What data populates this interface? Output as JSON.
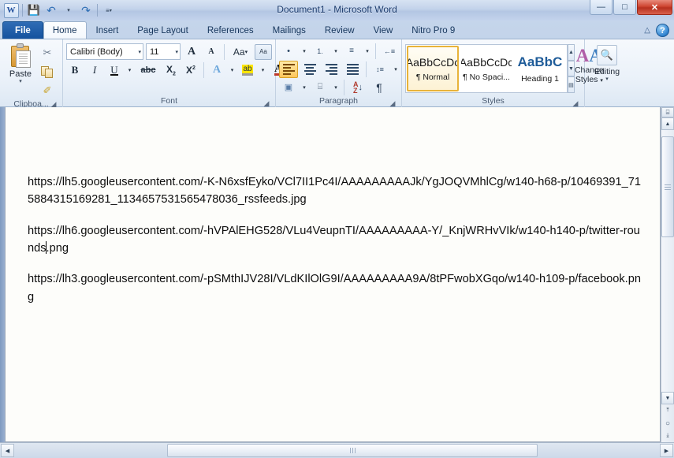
{
  "window": {
    "title": "Document1 - Microsoft Word",
    "quick_access": [
      {
        "name": "word-logo",
        "glyph": "W"
      },
      {
        "name": "save",
        "glyph": "💾"
      },
      {
        "name": "undo",
        "glyph": "↶"
      },
      {
        "name": "undo-dropdown",
        "glyph": "▾"
      },
      {
        "name": "redo",
        "glyph": "↷"
      },
      {
        "name": "customize-qat",
        "glyph": "▾"
      }
    ],
    "controls": {
      "minimize": "—",
      "maximize": "□",
      "close": "✕"
    }
  },
  "tabs": [
    {
      "label": "File",
      "active": false,
      "file": true
    },
    {
      "label": "Home",
      "active": true
    },
    {
      "label": "Insert",
      "active": false
    },
    {
      "label": "Page Layout",
      "active": false
    },
    {
      "label": "References",
      "active": false
    },
    {
      "label": "Mailings",
      "active": false
    },
    {
      "label": "Review",
      "active": false
    },
    {
      "label": "View",
      "active": false
    },
    {
      "label": "Nitro Pro 9",
      "active": false
    }
  ],
  "tab_right": {
    "minimize_ribbon": "△",
    "help": "?"
  },
  "ribbon": {
    "clipboard": {
      "label": "Clipboa...",
      "paste_label": "Paste",
      "paste_arrow": "▾",
      "cut": "✂",
      "copy": "copy",
      "format_painter": "✐",
      "dialog_launcher": "◢"
    },
    "font": {
      "label": "Font",
      "font_name": "Calibri (Body)",
      "font_size": "11",
      "dropdown_arrow": "▾",
      "grow_font": "A",
      "shrink_font": "A",
      "change_case": "Aa",
      "clear_formatting": "Aa",
      "bold": "B",
      "italic": "I",
      "underline": "U",
      "strikethrough": "abc",
      "subscript": "X",
      "subscript_idx": "2",
      "superscript": "X",
      "superscript_idx": "2",
      "text_effects": "A",
      "highlight": "ab",
      "font_color": "A",
      "dialog_launcher": "◢"
    },
    "paragraph": {
      "label": "Paragraph",
      "bullets": "•",
      "numbering": "1.",
      "multilevel": "≡",
      "decrease_indent": "←≡",
      "increase_indent": "→≡",
      "align_left": "left",
      "align_center": "center",
      "align_right": "right",
      "align_justify": "justify",
      "line_spacing": "↕≡",
      "shading": "▣",
      "borders": "⌸",
      "sort_a": "A",
      "sort_z": "Z",
      "sort_arrow": "↓",
      "show_marks": "¶",
      "dialog_launcher": "◢"
    },
    "styles": {
      "label": "Styles",
      "items": [
        {
          "preview": "AaBbCcDc",
          "name": "¶ Normal",
          "selected": true
        },
        {
          "preview": "AaBbCcDc",
          "name": "¶ No Spaci...",
          "selected": false
        },
        {
          "preview": "AaBbC",
          "name": "Heading 1",
          "selected": false,
          "heading": true
        }
      ],
      "scroll_up": "▲",
      "scroll_down": "▼",
      "more": "▤",
      "change_styles_line1": "Change",
      "change_styles_line2": "Styles",
      "change_styles_arrow": "▾",
      "dialog_launcher": "◢"
    },
    "editing": {
      "label": "Editing",
      "icon": "🔍",
      "arrow": "▾"
    }
  },
  "document": {
    "paragraphs": [
      {
        "text_before": "https://lh5.googleusercontent.com/-K-N6xsfEyko/VCl7II1Pc4I/AAAAAAAAAJk/YgJOQVMhlCg/w140-h68-p/10469391_715884315169281_1134657531565478036_rssfeeds.jpg",
        "caret": false,
        "text_after": ""
      },
      {
        "text_before": "https://lh6.googleusercontent.com/-hVPAlEHG528/VLu4VeupnTI/AAAAAAAAA-Y/_KnjWRHvVIk/w140-h140-p/twitter-rounds",
        "caret": true,
        "text_after": ".png"
      },
      {
        "text_before": "https://lh3.googleusercontent.com/-pSMthIJV28I/VLdKIlOlG9I/AAAAAAAAA9A/8tPFwobXGqo/w140-h109-p/facebook.png",
        "caret": false,
        "text_after": ""
      }
    ]
  },
  "scrollbars": {
    "vertical": {
      "ruler_toggle": "⌸",
      "up": "▲",
      "down": "▼",
      "prev_page": "⤒",
      "browse_object": "○",
      "next_page": "⤓"
    },
    "horizontal": {
      "left": "◀",
      "right": "▶"
    }
  },
  "colors": {
    "accent": "#15529e",
    "close_red": "#cf4632",
    "selection_gold": "#e8b33a",
    "heading_blue": "#1f5c99"
  }
}
